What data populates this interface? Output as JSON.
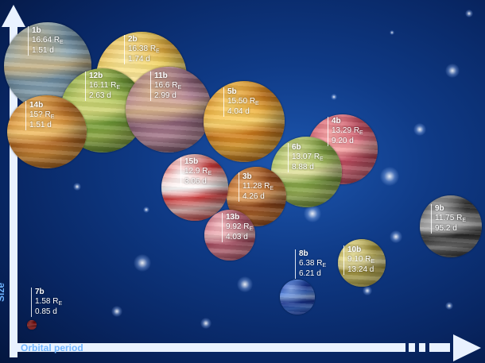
{
  "axes": {
    "x_label": "Orbital period",
    "y_label": "Size"
  },
  "radius_unit": "R",
  "radius_unit_sub": "E",
  "planets": [
    {
      "id": "1b",
      "size": "16.64",
      "period": "1.51 d",
      "colors": [
        "#9cb9c8",
        "#6a8aa0",
        "#c7b489"
      ]
    },
    {
      "id": "2b",
      "size": "16.38",
      "period": "1.74 d",
      "colors": [
        "#f6d862",
        "#e2a93a",
        "#f9e59a"
      ]
    },
    {
      "id": "12b",
      "size": "16.11",
      "period": "2.63 d",
      "colors": [
        "#a8c456",
        "#6f9a36",
        "#d2d77a"
      ]
    },
    {
      "id": "11b",
      "size": "16.6",
      "period": "2.99 d",
      "colors": [
        "#c795a8",
        "#8e6278",
        "#d6b18c"
      ]
    },
    {
      "id": "14b",
      "size": "15?",
      "period": "1.51 d",
      "colors": [
        "#e59a3e",
        "#b96a22",
        "#f1c06b"
      ]
    },
    {
      "id": "5b",
      "size": "15.50",
      "period": "4.04 d",
      "colors": [
        "#f3b03c",
        "#d27c1c",
        "#f8d06a"
      ]
    },
    {
      "id": "4b",
      "size": "13.29",
      "period": "9.20 d",
      "colors": [
        "#f27b8d",
        "#c9485e",
        "#f7a8a8"
      ]
    },
    {
      "id": "6b",
      "size": "13.07",
      "period": "8.88 d",
      "colors": [
        "#b7d26a",
        "#7fa43e",
        "#e2e2a0"
      ]
    },
    {
      "id": "15b",
      "size": "12.9",
      "period": "3.06 d",
      "colors": [
        "#ffd0cc",
        "#e03a3a",
        "#ffffff"
      ]
    },
    {
      "id": "3b",
      "size": "11.28",
      "period": "4.26 d",
      "colors": [
        "#d9803a",
        "#9c4b1c",
        "#e8a866"
      ]
    },
    {
      "id": "13b",
      "size": "9.92",
      "period": "4.03 d",
      "colors": [
        "#ef8fa1",
        "#c0566e",
        "#f6c0c4"
      ]
    },
    {
      "id": "9b",
      "size": "11.75",
      "period": "95.2 d",
      "colors": [
        "#8c8c8c",
        "#2e2e2e",
        "#bdbdbd"
      ]
    },
    {
      "id": "8b",
      "size": "6.38",
      "period": "6.21 d",
      "colors": [
        "#4f8bff",
        "#1c3fb8",
        "#8fb6ff"
      ]
    },
    {
      "id": "10b",
      "size": "9.10",
      "period": "13.24 d",
      "colors": [
        "#e7da78",
        "#b8a640",
        "#f3eaa8"
      ]
    },
    {
      "id": "7b",
      "size": "1.58",
      "period": "0.85 d",
      "colors": [
        "#e02222",
        "#8a0b0b",
        "#ff6b6b"
      ]
    }
  ]
}
